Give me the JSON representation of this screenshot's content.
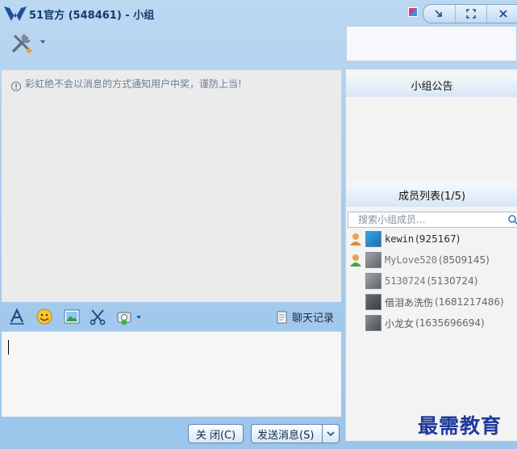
{
  "window": {
    "title": "51官方 (548461) - 小组"
  },
  "chat": {
    "notice": "彩虹绝不会以消息的方式通知用户中奖，谨防上当!",
    "notice_icon": "info-circle-icon"
  },
  "edit_toolbar": {
    "icons": [
      "font-icon",
      "emoji-icon",
      "image-icon",
      "scissors-icon",
      "screenshot-dropdown-icon"
    ],
    "history_label": "聊天记录"
  },
  "footer": {
    "close_label": "关 闭(C)",
    "send_label": "发送消息(S)"
  },
  "group": {
    "announcement_title": "小组公告",
    "members_title": "成员列表(1/5)",
    "search_placeholder": "搜索小组成员...",
    "members": [
      {
        "name": "kewin",
        "id": "(925167)",
        "online": true
      },
      {
        "name": "MyLove520",
        "id": "(8509145)",
        "online": true
      },
      {
        "name": "5130724",
        "id": "(5130724)",
        "online": false
      },
      {
        "name": "借泪あ洗伤",
        "id": "(1681217486)",
        "online": false
      },
      {
        "name": "小龙女",
        "id": "(1635696694)",
        "online": false
      }
    ]
  },
  "watermark": "最需教育",
  "colors": {
    "accent": "#1f7fd6",
    "watermark": "#1f3a9a"
  }
}
